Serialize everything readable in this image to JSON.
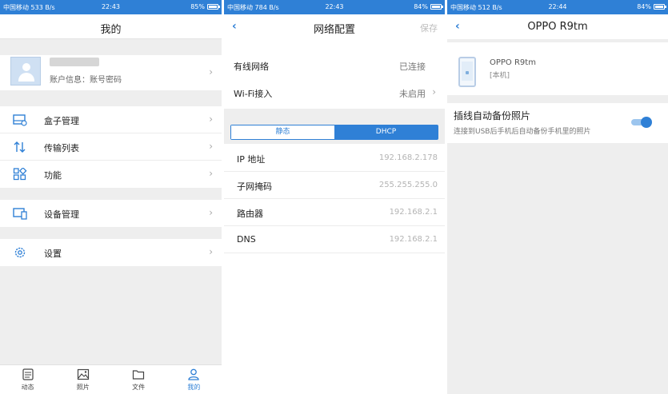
{
  "screens": [
    {
      "status": {
        "left": "中国移动 533 B/s",
        "time": "22:43",
        "battery": "85%",
        "battery_level": 0.85
      },
      "title": "我的",
      "profile": {
        "account_info": "账户信息：账号密码"
      },
      "menu_groups": [
        [
          {
            "label": "盒子管理",
            "icon": "box-icon"
          },
          {
            "label": "传输列表",
            "icon": "transfer-icon"
          },
          {
            "label": "功能",
            "icon": "grid-icon"
          }
        ],
        [
          {
            "label": "设备管理",
            "icon": "devices-icon"
          }
        ],
        [
          {
            "label": "设置",
            "icon": "gear-icon"
          }
        ]
      ],
      "tabs": [
        {
          "label": "动态",
          "icon": "dynamic-icon"
        },
        {
          "label": "照片",
          "icon": "photo-icon"
        },
        {
          "label": "文件",
          "icon": "folder-icon"
        },
        {
          "label": "我的",
          "icon": "user-icon",
          "active": true
        }
      ]
    },
    {
      "status": {
        "left": "中国移动 784 B/s",
        "time": "22:43",
        "battery": "84%",
        "battery_level": 0.84
      },
      "title": "网络配置",
      "save": "保存",
      "rows": [
        {
          "label": "有线网络",
          "value": "已连接"
        },
        {
          "label": "Wi-Fi接入",
          "value": "未启用"
        }
      ],
      "segments": [
        "静态",
        "DHCP"
      ],
      "ip_rows": [
        {
          "label": "IP 地址",
          "value": "192.168.2.178"
        },
        {
          "label": "子网掩码",
          "value": "255.255.255.0"
        },
        {
          "label": "路由器",
          "value": "192.168.2.1"
        },
        {
          "label": "DNS",
          "value": "192.168.2.1"
        }
      ]
    },
    {
      "status": {
        "left": "中国移动 512 B/s",
        "time": "22:44",
        "battery": "84%",
        "battery_level": 0.84
      },
      "title": "OPPO R9tm",
      "device": {
        "name": "OPPO R9tm",
        "tag": "[本机]"
      },
      "backup": {
        "title": "插线自动备份照片",
        "desc": "连接到USB后手机后自动备份手机里的照片",
        "enabled": true
      }
    }
  ],
  "colors": {
    "accent": "#2f80d6",
    "background": "#eeeeee"
  }
}
